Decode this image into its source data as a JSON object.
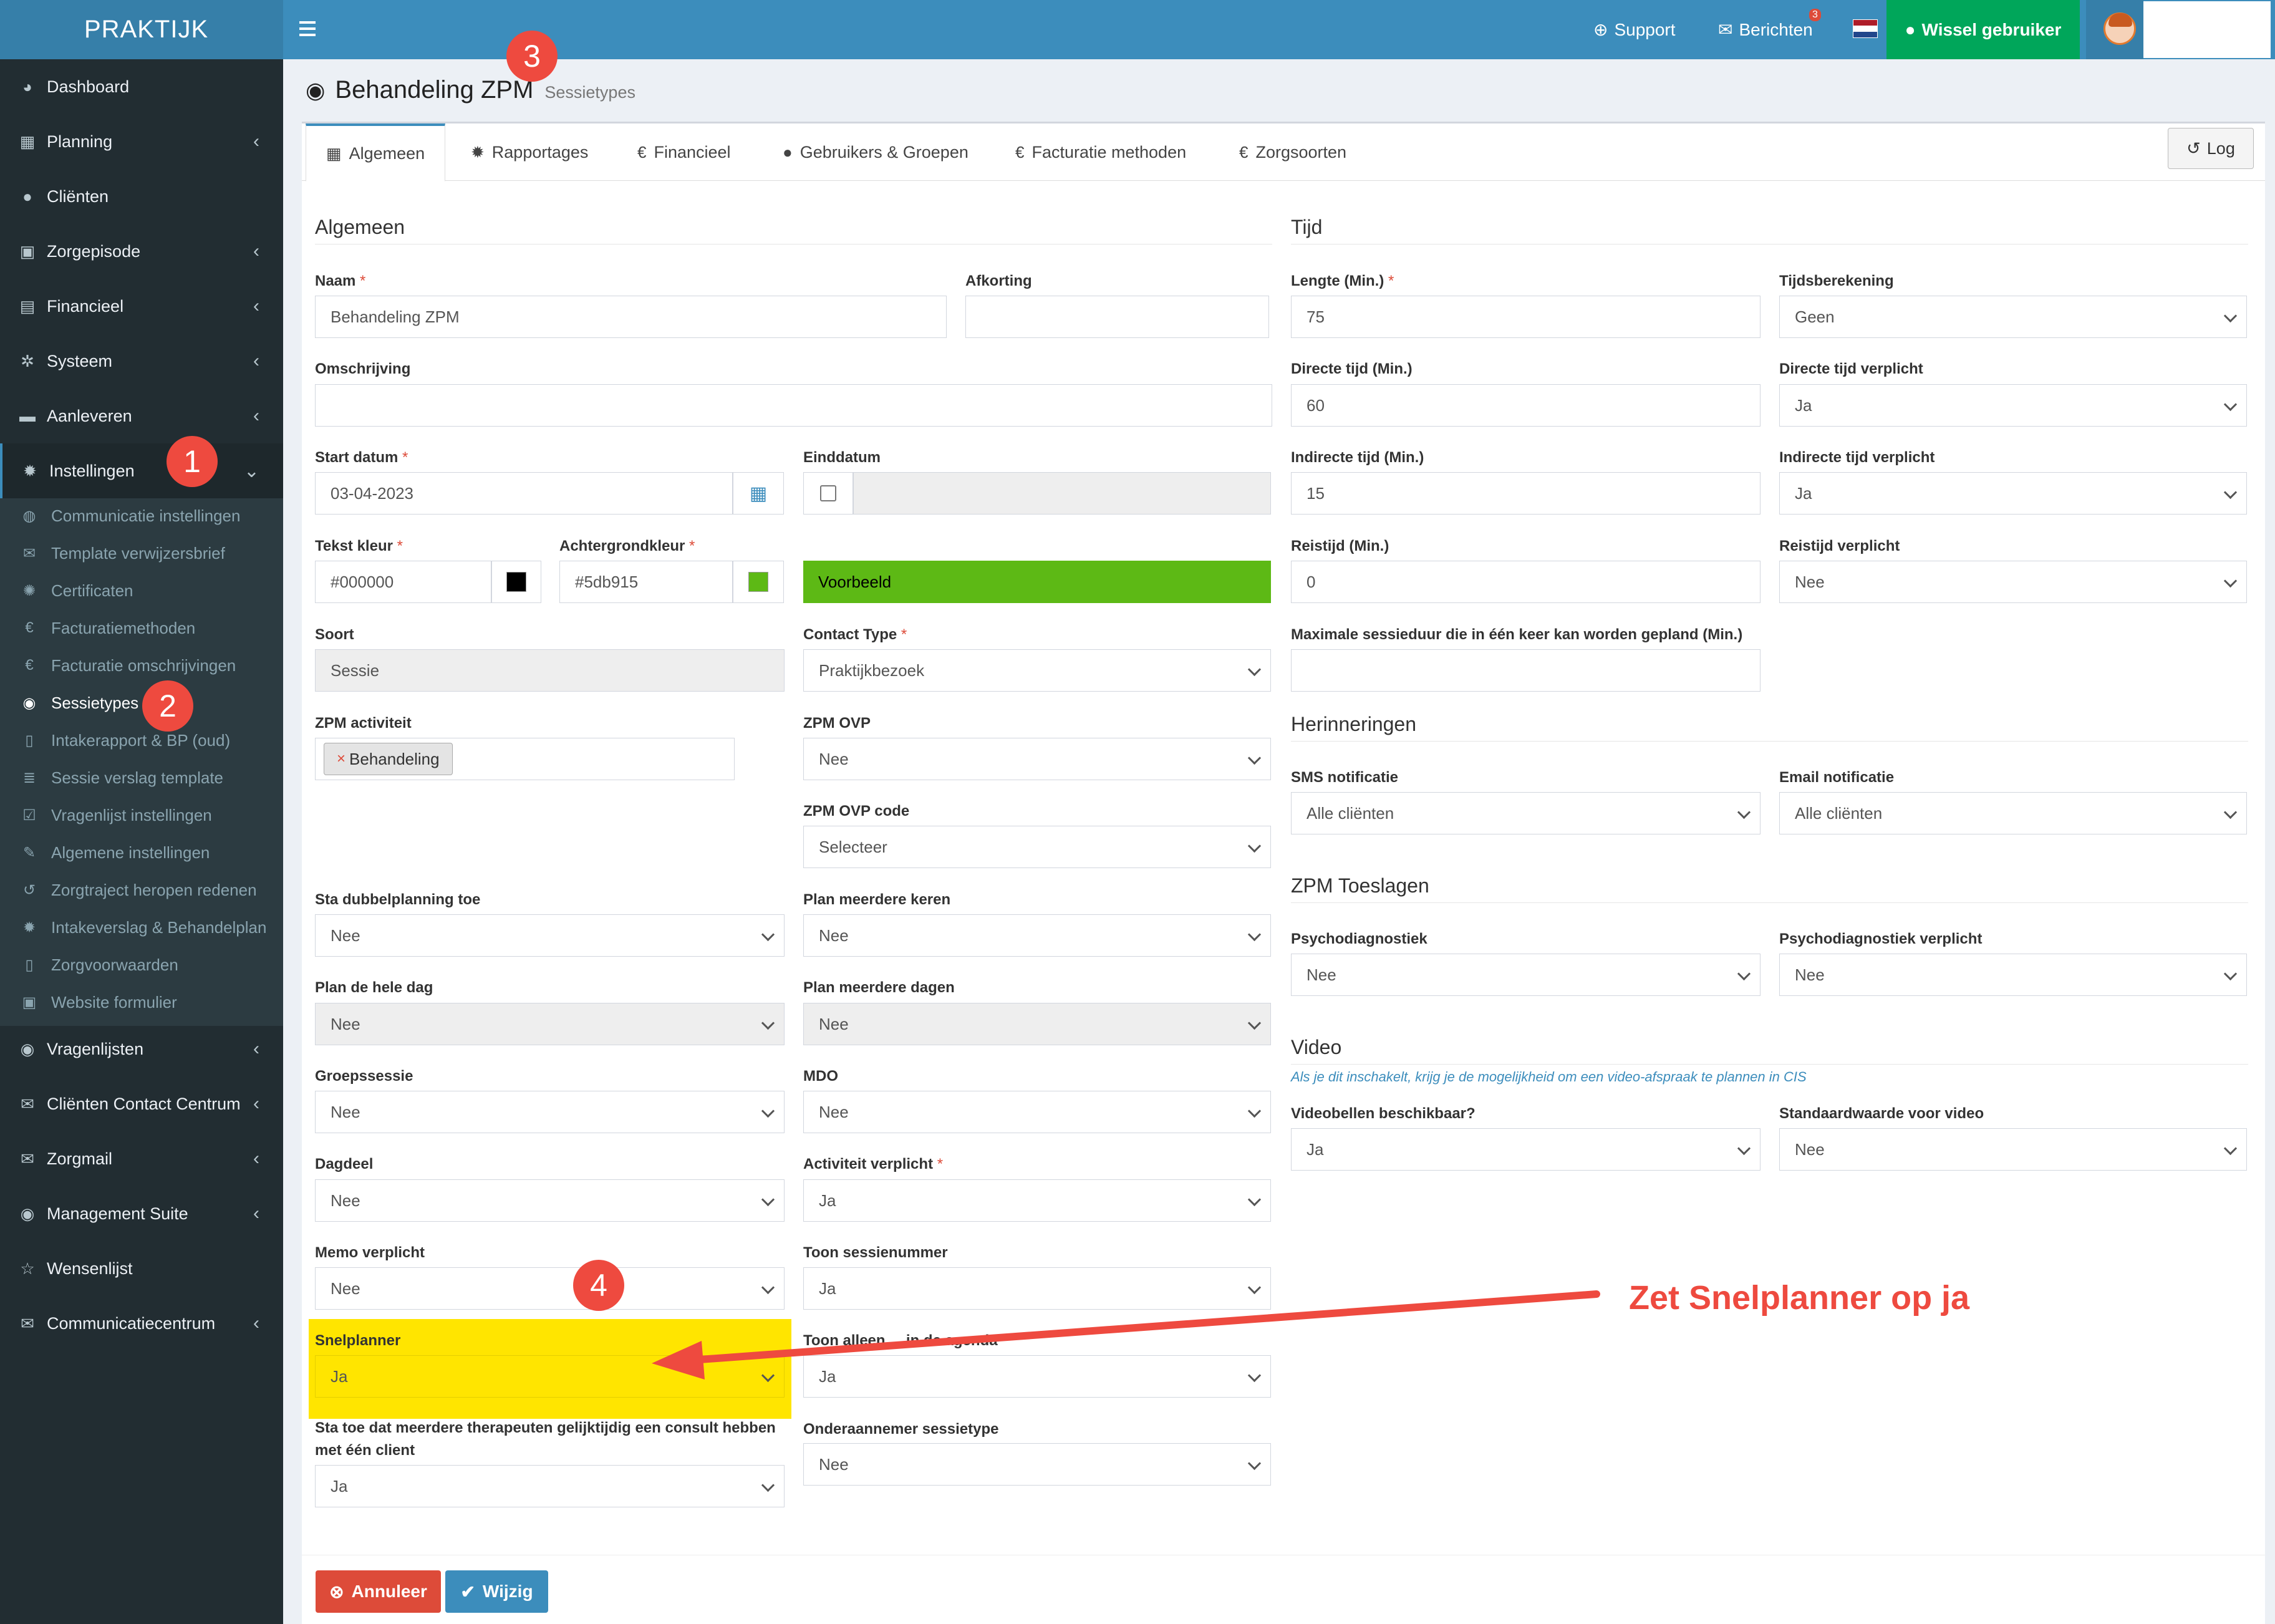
{
  "brand": "PRAKTIJK",
  "topbar": {
    "support": "Support",
    "berichten": "Berichten",
    "berichten_badge": "3",
    "wissel": "Wissel gebruiker",
    "flag_colors": [
      "#ae1c28",
      "#ffffff",
      "#21468b"
    ]
  },
  "sidebar": {
    "items": [
      {
        "label": "Dashboard",
        "icon": "dashboard-icon",
        "glyph": "◕",
        "chevron": false
      },
      {
        "label": "Planning",
        "icon": "calendar-icon",
        "glyph": "▦",
        "chevron": true
      },
      {
        "label": "Cliënten",
        "icon": "user-icon",
        "glyph": "●",
        "chevron": false
      },
      {
        "label": "Zorgepisode",
        "icon": "medkit-icon",
        "glyph": "▣",
        "chevron": true
      },
      {
        "label": "Financieel",
        "icon": "book-icon",
        "glyph": "▤",
        "chevron": true
      },
      {
        "label": "Systeem",
        "icon": "cogs-icon",
        "glyph": "✲",
        "chevron": true
      },
      {
        "label": "Aanleveren",
        "icon": "truck-icon",
        "glyph": "▬",
        "chevron": true
      },
      {
        "label": "Instellingen",
        "icon": "gear-icon",
        "glyph": "✹",
        "chevron": true,
        "expanded": true
      }
    ],
    "submenu": [
      {
        "label": "Communicatie instellingen",
        "icon": "comments-icon",
        "glyph": "◍"
      },
      {
        "label": "Template verwijzersbrief",
        "icon": "envelope-icon",
        "glyph": "✉"
      },
      {
        "label": "Certificaten",
        "icon": "certificate-icon",
        "glyph": "✺"
      },
      {
        "label": "Facturatiemethoden",
        "icon": "euro-icon",
        "glyph": "€"
      },
      {
        "label": "Facturatie omschrijvingen",
        "icon": "euro-icon",
        "glyph": "€"
      },
      {
        "label": "Sessietypes",
        "icon": "globe-icon",
        "glyph": "◉",
        "current": true
      },
      {
        "label": "Intakerapport & BP (oud)",
        "icon": "file-icon",
        "glyph": "▯"
      },
      {
        "label": "Sessie verslag template",
        "icon": "list-icon",
        "glyph": "≣"
      },
      {
        "label": "Vragenlijst instellingen",
        "icon": "check-square-icon",
        "glyph": "☑"
      },
      {
        "label": "Algemene instellingen",
        "icon": "wrench-icon",
        "glyph": "✎"
      },
      {
        "label": "Zorgtraject heropen redenen",
        "icon": "history-icon",
        "glyph": "↺"
      },
      {
        "label": "Intakeverslag & Behandelplan",
        "icon": "cog-icon",
        "glyph": "✹"
      },
      {
        "label": "Zorgvoorwaarden",
        "icon": "file-pdf-icon",
        "glyph": "▯"
      },
      {
        "label": "Website formulier",
        "icon": "medkit-icon",
        "glyph": "▣"
      }
    ],
    "items_bottom": [
      {
        "label": "Vragenlijsten",
        "icon": "globe-icon",
        "glyph": "◉",
        "chevron": true
      },
      {
        "label": "Cliënten Contact Centrum",
        "icon": "envelope-icon",
        "glyph": "✉",
        "chevron": true
      },
      {
        "label": "Zorgmail",
        "icon": "envelope-icon",
        "glyph": "✉",
        "chevron": true
      },
      {
        "label": "Management Suite",
        "icon": "globe-icon",
        "glyph": "◉",
        "chevron": true
      },
      {
        "label": "Wensenlijst",
        "icon": "star-icon",
        "glyph": "☆",
        "chevron": false
      },
      {
        "label": "Communicatiecentrum",
        "icon": "envelope-icon",
        "glyph": "✉",
        "chevron": true
      }
    ]
  },
  "page": {
    "title": "Behandeling ZPM",
    "subtitle": "Sessietypes"
  },
  "tabs": [
    {
      "label": "Algemeen",
      "icon": "table-icon",
      "glyph": "▦",
      "active": true
    },
    {
      "label": "Rapportages",
      "icon": "gear-icon",
      "glyph": "✹"
    },
    {
      "label": "Financieel",
      "icon": "euro-icon",
      "glyph": "€"
    },
    {
      "label": "Gebruikers & Groepen",
      "icon": "user-icon",
      "glyph": "●"
    },
    {
      "label": "Facturatie methoden",
      "icon": "euro-icon",
      "glyph": "€"
    },
    {
      "label": "Zorgsoorten",
      "icon": "euro-icon",
      "glyph": "€"
    }
  ],
  "log_label": "Log",
  "sections": {
    "algemeen": "Algemeen",
    "tijd": "Tijd",
    "herinneringen": "Herinneringen",
    "zpm_toeslagen": "ZPM Toeslagen",
    "video": "Video",
    "video_hint": "Als je dit inschakelt, krijg je de mogelijkheid om een video-afspraak te plannen in CIS"
  },
  "form": {
    "naam": {
      "label": "Naam",
      "value": "Behandeling ZPM",
      "required": true
    },
    "afkorting": {
      "label": "Afkorting",
      "value": ""
    },
    "omschrijving": {
      "label": "Omschrijving",
      "value": ""
    },
    "start_datum": {
      "label": "Start datum",
      "value": "03-04-2023",
      "required": true
    },
    "einddatum": {
      "label": "Einddatum",
      "checked": false
    },
    "tekst_kleur": {
      "label": "Tekst kleur",
      "value": "#000000",
      "required": true,
      "color": "#000000"
    },
    "achtergrondkleur": {
      "label": "Achtergrondkleur",
      "value": "#5db915",
      "required": true,
      "color": "#5db915"
    },
    "voorbeeld": {
      "label": "Voorbeeld",
      "bg": "#5db915"
    },
    "soort": {
      "label": "Soort",
      "value": "Sessie"
    },
    "contact_type": {
      "label": "Contact Type",
      "value": "Praktijkbezoek",
      "required": true
    },
    "zpm_activiteit": {
      "label": "ZPM activiteit",
      "tag": "Behandeling",
      "tag_remove": "×"
    },
    "zpm_ovp": {
      "label": "ZPM OVP",
      "value": "Nee"
    },
    "zpm_ovp_code": {
      "label": "ZPM OVP code",
      "value": "Selecteer"
    },
    "sta_dubbelplanning": {
      "label": "Sta dubbelplanning toe",
      "value": "Nee"
    },
    "plan_meerdere_keren": {
      "label": "Plan meerdere keren",
      "value": "Nee"
    },
    "plan_hele_dag": {
      "label": "Plan de hele dag",
      "value": "Nee"
    },
    "plan_meerdere_dagen": {
      "label": "Plan meerdere dagen",
      "value": "Nee"
    },
    "groepssessie": {
      "label": "Groepssessie",
      "value": "Nee"
    },
    "mdo": {
      "label": "MDO",
      "value": "Nee"
    },
    "dagdeel": {
      "label": "Dagdeel",
      "value": "Nee"
    },
    "activiteit_verplicht": {
      "label": "Activiteit verplicht",
      "value": "Ja",
      "required": true
    },
    "memo_verplicht": {
      "label": "Memo verplicht",
      "value": "Nee"
    },
    "toon_sessienummer": {
      "label": "Toon sessienummer",
      "value": "Ja"
    },
    "snelplanner": {
      "label": "Snelplanner",
      "value": "Ja"
    },
    "toon_alleen": {
      "label": "Toon alleen ... in de agenda",
      "value": "Ja"
    },
    "sta_toe_meerdere": {
      "label": "Sta toe dat meerdere therapeuten gelijktijdig een consult hebben met één client",
      "value": "Ja"
    },
    "onderaannemer": {
      "label": "Onderaannemer sessietype",
      "value": "Nee"
    },
    "lengte": {
      "label": "Lengte (Min.)",
      "value": "75",
      "required": true
    },
    "tijdsberekening": {
      "label": "Tijdsberekening",
      "value": "Geen"
    },
    "directe_tijd": {
      "label": "Directe tijd (Min.)",
      "value": "60"
    },
    "directe_tijd_verplicht": {
      "label": "Directe tijd verplicht",
      "value": "Ja"
    },
    "indirecte_tijd": {
      "label": "Indirecte tijd (Min.)",
      "value": "15"
    },
    "indirecte_tijd_verplicht": {
      "label": "Indirecte tijd verplicht",
      "value": "Ja"
    },
    "reistijd": {
      "label": "Reistijd (Min.)",
      "value": "0"
    },
    "reistijd_verplicht": {
      "label": "Reistijd verplicht",
      "value": "Nee"
    },
    "max_sessieduur": {
      "label": "Maximale sessieduur die in één keer kan worden gepland (Min.)",
      "value": ""
    },
    "sms_notificatie": {
      "label": "SMS notificatie",
      "value": "Alle cliënten"
    },
    "email_notificatie": {
      "label": "Email notificatie",
      "value": "Alle cliënten"
    },
    "psychodiagnostiek": {
      "label": "Psychodiagnostiek",
      "value": "Nee"
    },
    "psychodiagnostiek_verplicht": {
      "label": "Psychodiagnostiek verplicht",
      "value": "Nee"
    },
    "videobellen": {
      "label": "Videobellen beschikbaar?",
      "value": "Ja"
    },
    "standaard_video": {
      "label": "Standaardwaarde voor video",
      "value": "Nee"
    }
  },
  "buttons": {
    "annuleer": "Annuleer",
    "wijzig": "Wijzig"
  },
  "annotations": {
    "markers": [
      "1",
      "2",
      "3",
      "4"
    ],
    "instruction": "Zet Snelplanner op ja",
    "highlight_color": "#ffe500",
    "accent": "#ee4a3f"
  }
}
